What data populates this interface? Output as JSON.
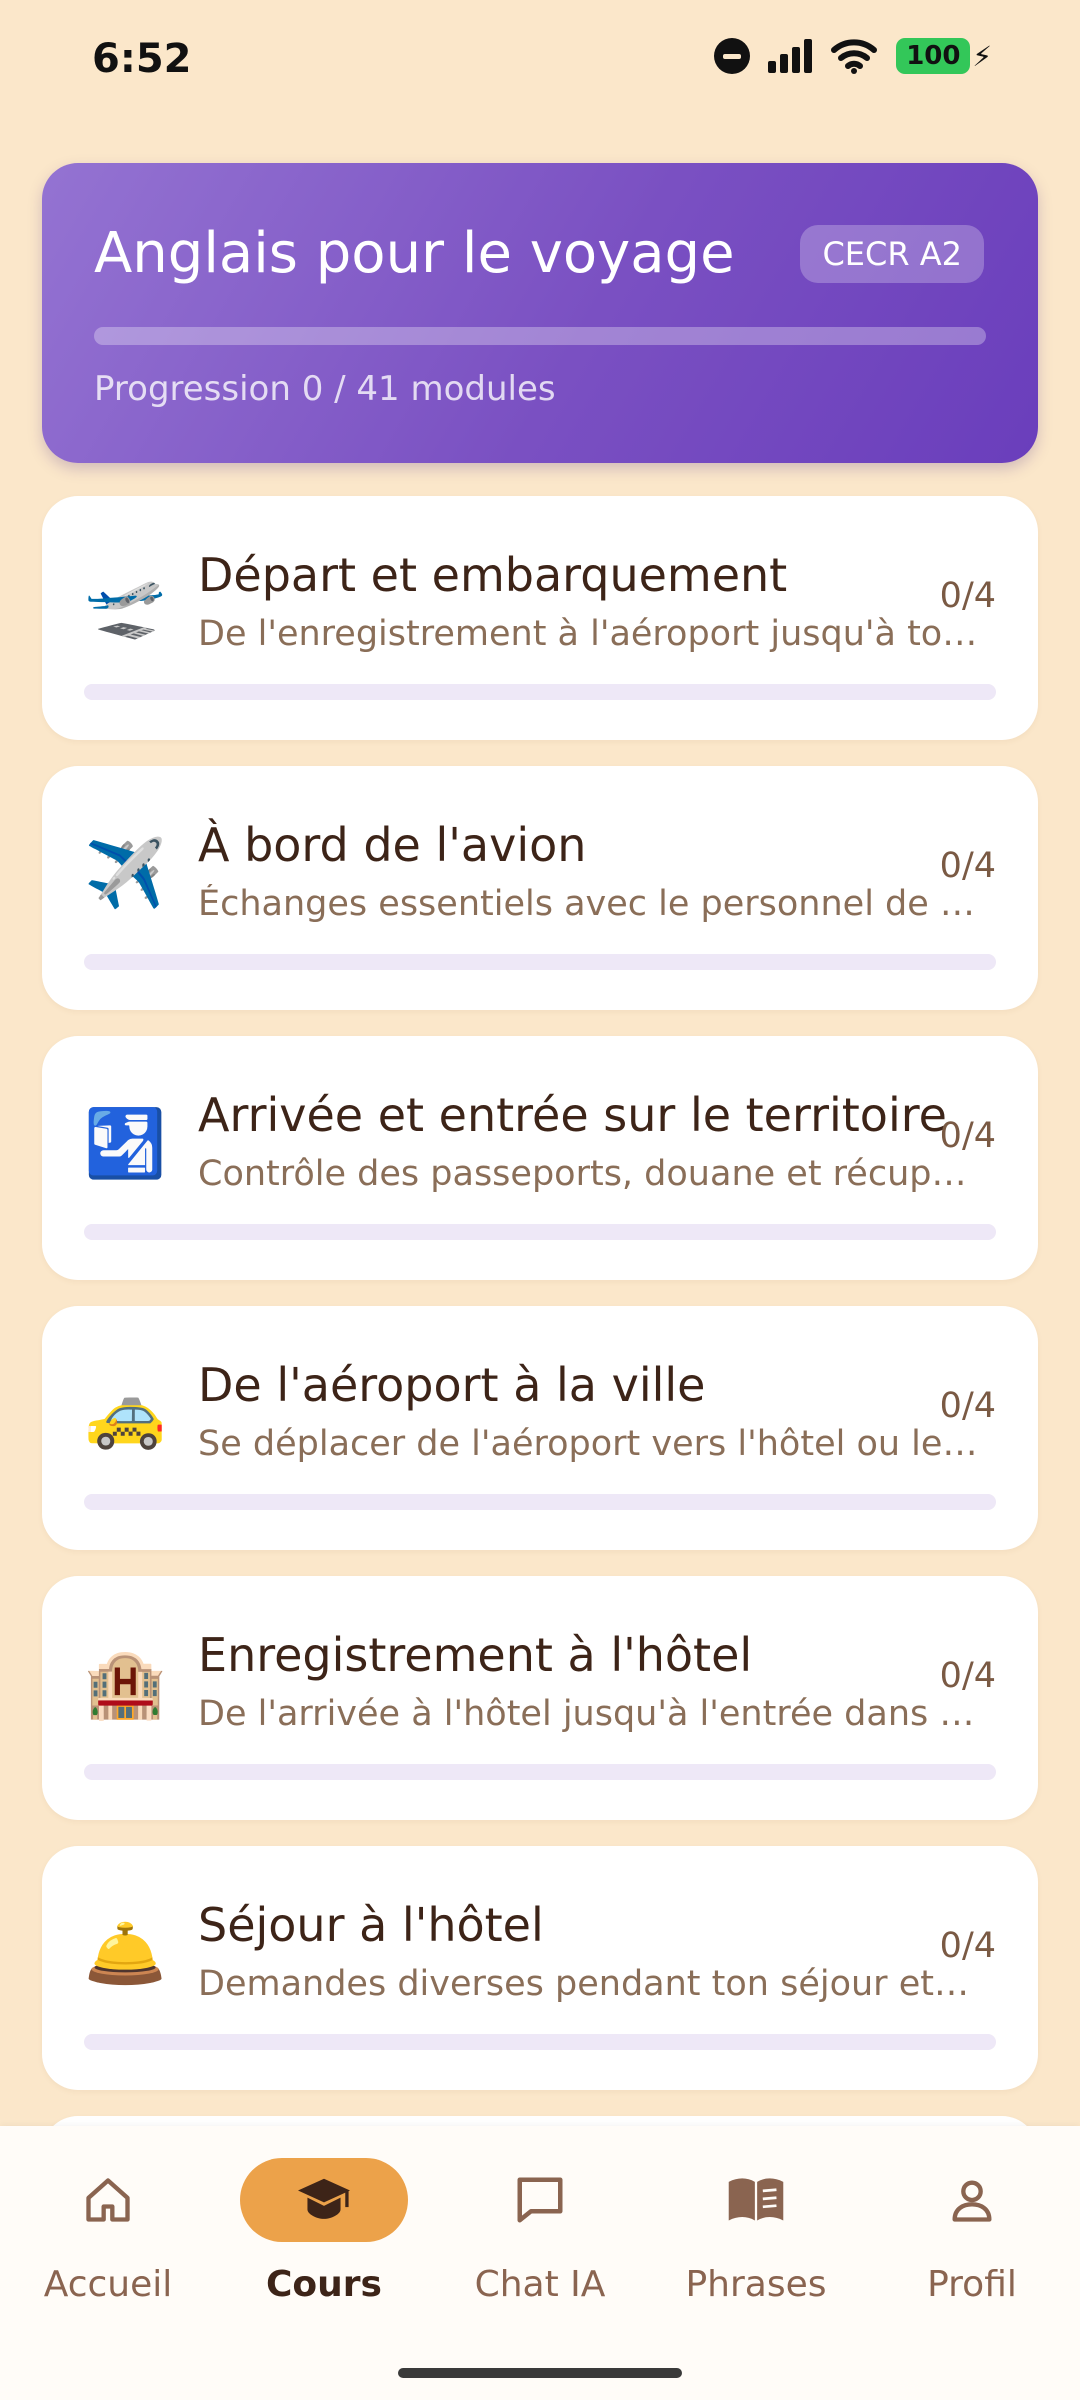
{
  "status_bar": {
    "time": "6:52",
    "battery": "100"
  },
  "course": {
    "title": "Anglais pour le voyage",
    "level": "CECR A2",
    "progress_label": "Progression 0 / 41 modules",
    "progress_fraction": 0
  },
  "modules": [
    {
      "icon": "🛫",
      "icon_name": "airplane-departure-icon",
      "title": "Départ et embarquement",
      "description": "De l'enregistrement à l'aéroport jusqu'à ton embarquement",
      "count": "0/4",
      "progress": 0
    },
    {
      "icon": "✈️",
      "icon_name": "airplane-icon",
      "title": "À bord de l'avion",
      "description": "Échanges essentiels avec le personnel de bord pendant le vol",
      "count": "0/4",
      "progress": 0
    },
    {
      "icon": "🛂",
      "icon_name": "passport-control-icon",
      "title": "Arrivée et entrée sur le territoire",
      "description": "Contrôle des passeports, douane et récupération des bagages",
      "count": "0/4",
      "progress": 0
    },
    {
      "icon": "🚕",
      "icon_name": "taxi-icon",
      "title": "De l'aéroport à la ville",
      "description": "Se déplacer de l'aéroport vers l'hôtel ou le centre-ville",
      "count": "0/4",
      "progress": 0
    },
    {
      "icon": "🏨",
      "icon_name": "hotel-icon",
      "title": "Enregistrement à l'hôtel",
      "description": "De l'arrivée à l'hôtel jusqu'à l'entrée dans ta chambre",
      "count": "0/4",
      "progress": 0
    },
    {
      "icon": "🛎️",
      "icon_name": "bellhop-bell-icon",
      "title": "Séjour à l'hôtel",
      "description": "Demandes diverses pendant ton séjour et résolution de problèmes",
      "count": "0/4",
      "progress": 0
    }
  ],
  "nav": [
    {
      "label": "Accueil",
      "icon_name": "home-icon"
    },
    {
      "label": "Cours",
      "icon_name": "graduation-cap-icon",
      "active": true
    },
    {
      "label": "Chat IA",
      "icon_name": "chat-bubble-icon"
    },
    {
      "label": "Phrases",
      "icon_name": "book-open-icon"
    },
    {
      "label": "Profil",
      "icon_name": "person-icon"
    }
  ]
}
